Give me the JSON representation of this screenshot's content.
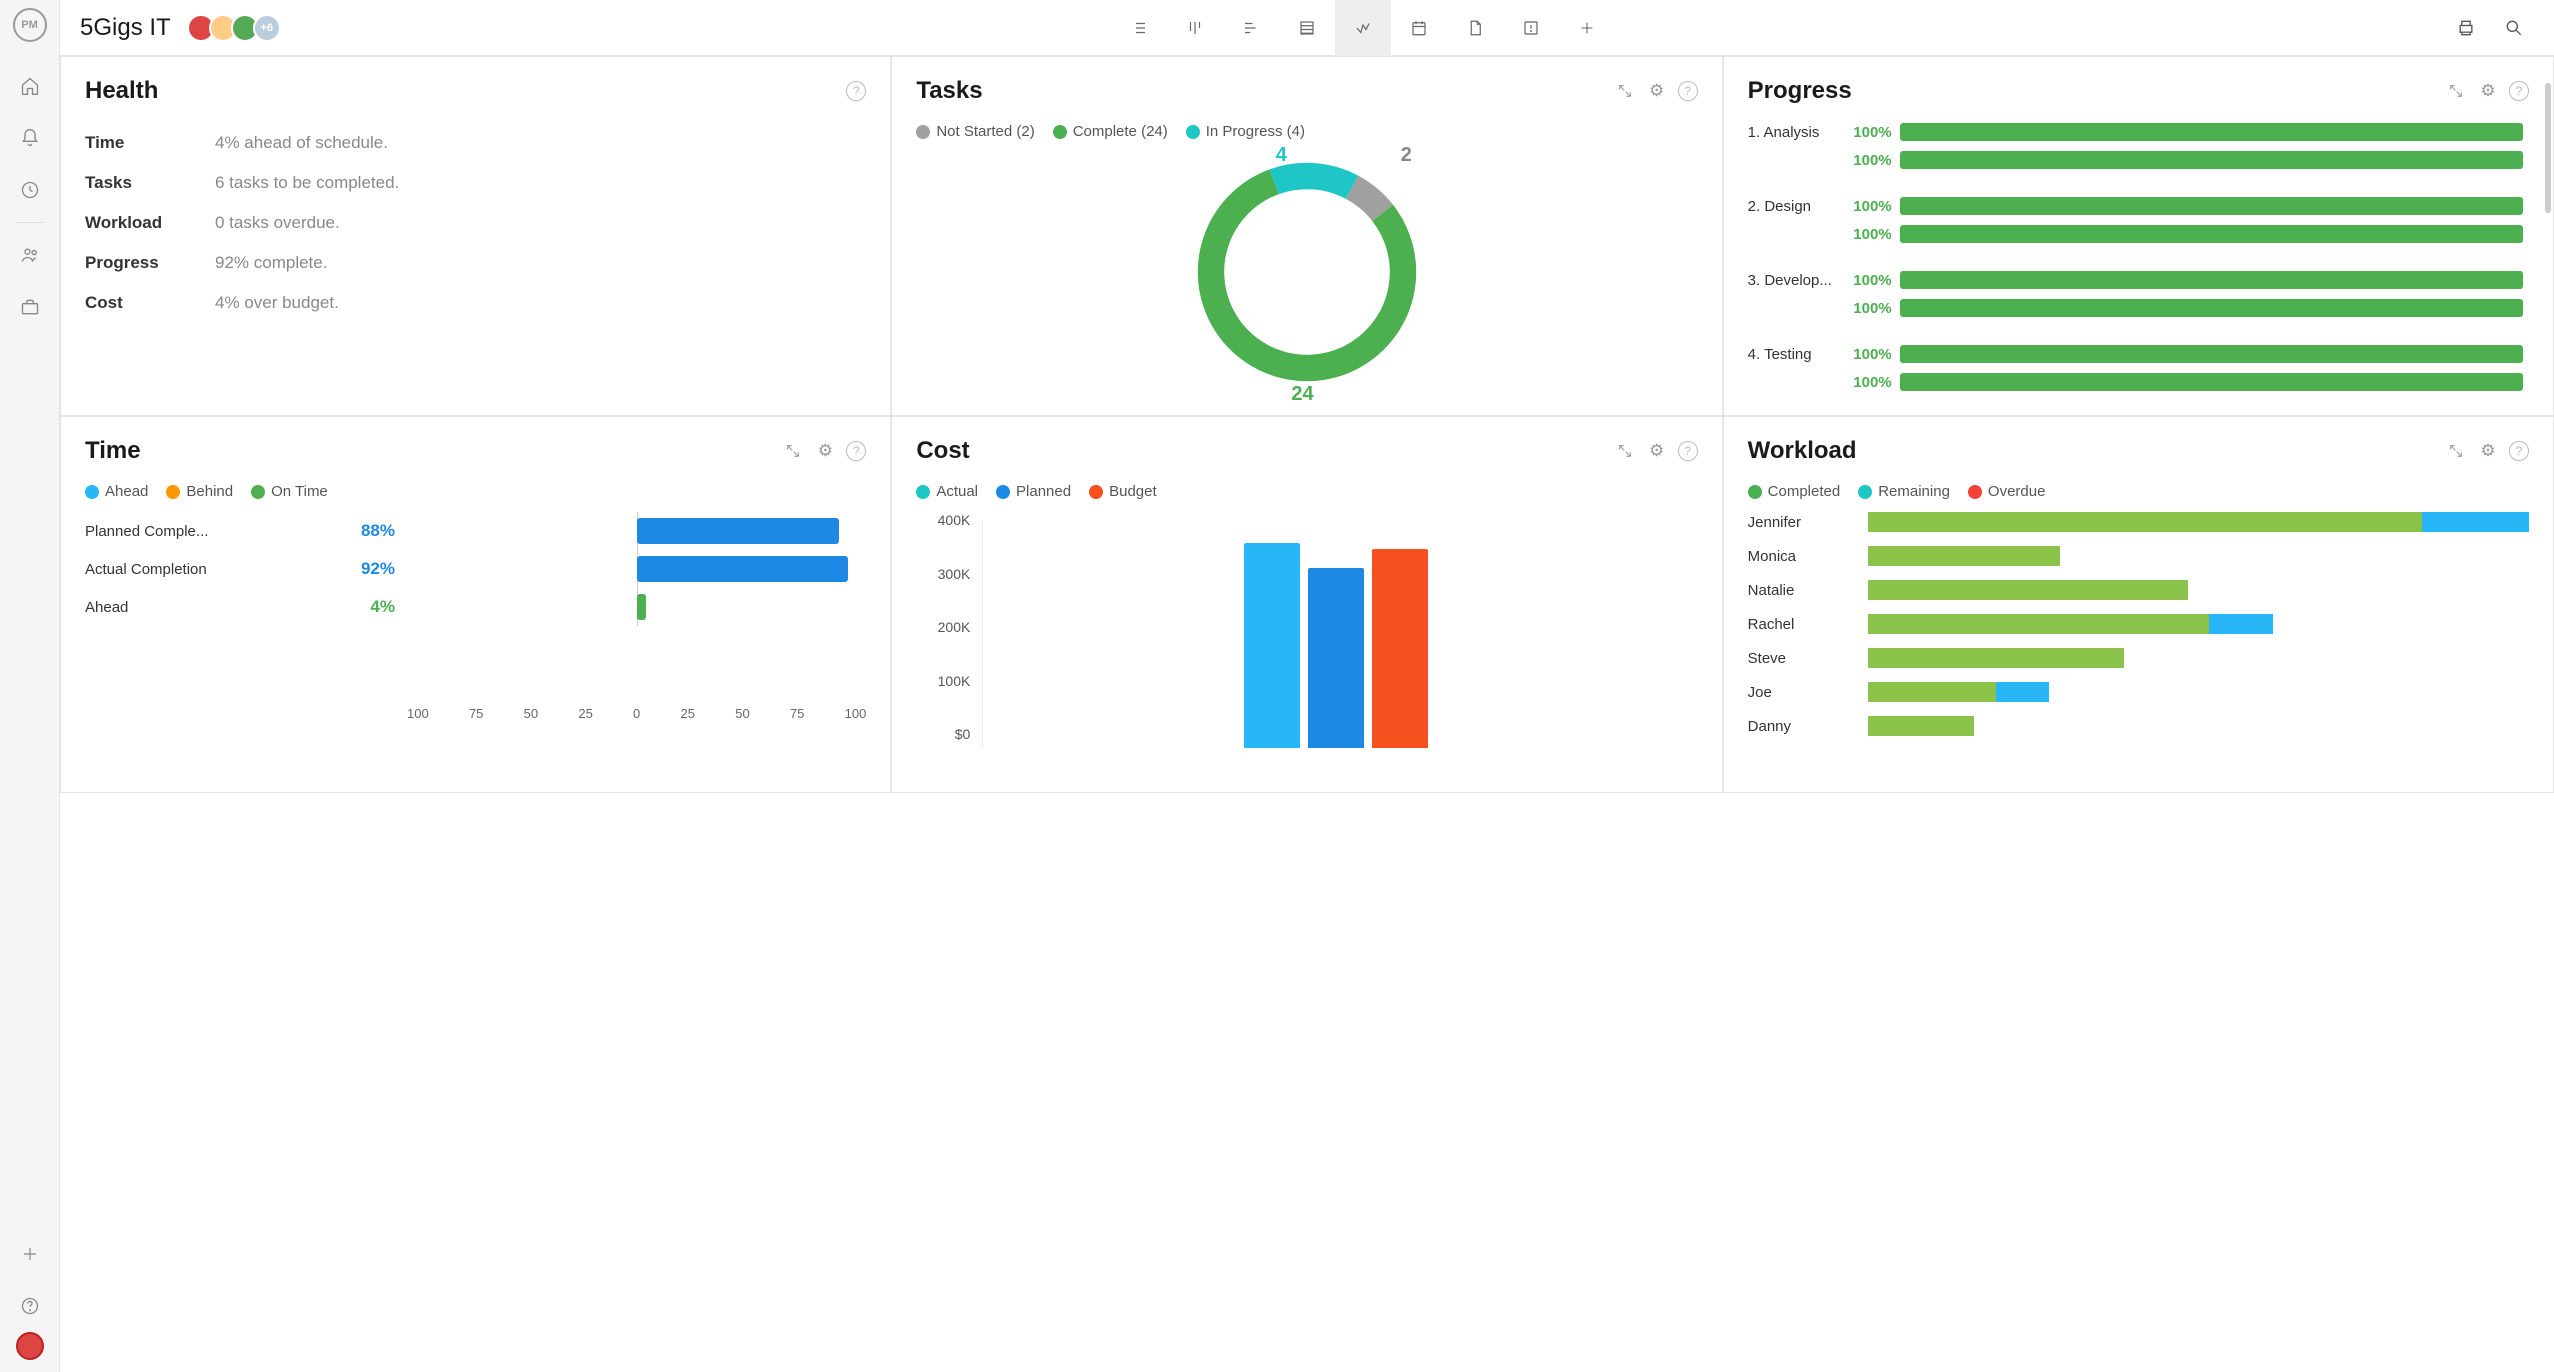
{
  "app": {
    "logo": "PM",
    "project_title": "5Gigs IT"
  },
  "avatars": {
    "more_label": "+6"
  },
  "colors": {
    "green": "#4caf50",
    "teal": "#1fc6c6",
    "blue": "#1e88e5",
    "lightblue": "#29b6f6",
    "orange": "#f4511e",
    "grey": "#a0a0a0",
    "olive": "#8bc34a"
  },
  "health": {
    "title": "Health",
    "rows": [
      {
        "label": "Time",
        "value": "4% ahead of schedule."
      },
      {
        "label": "Tasks",
        "value": "6 tasks to be completed."
      },
      {
        "label": "Workload",
        "value": "0 tasks overdue."
      },
      {
        "label": "Progress",
        "value": "92% complete."
      },
      {
        "label": "Cost",
        "value": "4% over budget."
      }
    ]
  },
  "tasks": {
    "title": "Tasks",
    "legend": [
      {
        "label": "Not Started (2)",
        "color": "#a0a0a0",
        "value": 2
      },
      {
        "label": "Complete (24)",
        "color": "#4caf50",
        "value": 24
      },
      {
        "label": "In Progress (4)",
        "color": "#1fc6c6",
        "value": 4
      }
    ],
    "labels": {
      "not_started": "2",
      "in_progress": "4",
      "complete": "24"
    }
  },
  "progress": {
    "title": "Progress",
    "groups": [
      {
        "name": "1. Analysis",
        "bars": [
          100,
          100
        ]
      },
      {
        "name": "2. Design",
        "bars": [
          100,
          100
        ]
      },
      {
        "name": "3. Develop...",
        "bars": [
          100,
          100
        ]
      },
      {
        "name": "4. Testing",
        "bars": [
          100,
          100
        ]
      }
    ]
  },
  "time": {
    "title": "Time",
    "legend": [
      {
        "label": "Ahead",
        "color": "#29b6f6"
      },
      {
        "label": "Behind",
        "color": "#ff9800"
      },
      {
        "label": "On Time",
        "color": "#4caf50"
      }
    ],
    "rows": [
      {
        "label": "Planned Comple...",
        "pct": "88%",
        "value": 88,
        "color": "#1e88e5"
      },
      {
        "label": "Actual Completion",
        "pct": "92%",
        "value": 92,
        "color": "#1e88e5"
      },
      {
        "label": "Ahead",
        "pct": "4%",
        "value": 4,
        "color": "#4caf50"
      }
    ],
    "axis": [
      "100",
      "75",
      "50",
      "25",
      "0",
      "25",
      "50",
      "75",
      "100"
    ]
  },
  "cost": {
    "title": "Cost",
    "legend": [
      {
        "label": "Actual",
        "color": "#1fc6c6"
      },
      {
        "label": "Planned",
        "color": "#1e88e5"
      },
      {
        "label": "Budget",
        "color": "#f4511e"
      }
    ],
    "y_ticks": [
      "400K",
      "300K",
      "200K",
      "100K",
      "$0"
    ],
    "bars": [
      {
        "name": "Actual",
        "value": 360,
        "color": "#29b6f6"
      },
      {
        "name": "Planned",
        "value": 315,
        "color": "#1e88e5"
      },
      {
        "name": "Budget",
        "value": 350,
        "color": "#f4511e"
      }
    ],
    "y_max": 400
  },
  "workload": {
    "title": "Workload",
    "legend": [
      {
        "label": "Completed",
        "color": "#4caf50"
      },
      {
        "label": "Remaining",
        "color": "#1fc6c6"
      },
      {
        "label": "Overdue",
        "color": "#f44336"
      }
    ],
    "rows": [
      {
        "name": "Jennifer",
        "completed": 52,
        "remaining": 10,
        "overdue": 0
      },
      {
        "name": "Monica",
        "completed": 18,
        "remaining": 0,
        "overdue": 0
      },
      {
        "name": "Natalie",
        "completed": 30,
        "remaining": 0,
        "overdue": 0
      },
      {
        "name": "Rachel",
        "completed": 32,
        "remaining": 6,
        "overdue": 0
      },
      {
        "name": "Steve",
        "completed": 24,
        "remaining": 0,
        "overdue": 0
      },
      {
        "name": "Joe",
        "completed": 12,
        "remaining": 5,
        "overdue": 0
      },
      {
        "name": "Danny",
        "completed": 10,
        "remaining": 0,
        "overdue": 0
      }
    ],
    "max": 62
  },
  "chart_data": [
    {
      "type": "pie",
      "title": "Tasks",
      "series": [
        {
          "name": "Not Started",
          "value": 2
        },
        {
          "name": "In Progress",
          "value": 4
        },
        {
          "name": "Complete",
          "value": 24
        }
      ]
    },
    {
      "type": "bar",
      "title": "Progress",
      "categories": [
        "1. Analysis",
        "1. Analysis",
        "2. Design",
        "2. Design",
        "3. Development",
        "3. Development",
        "4. Testing",
        "4. Testing"
      ],
      "values": [
        100,
        100,
        100,
        100,
        100,
        100,
        100,
        100
      ],
      "xlabel": "",
      "ylabel": "%",
      "ylim": [
        0,
        100
      ]
    },
    {
      "type": "bar",
      "title": "Time",
      "categories": [
        "Planned Completion",
        "Actual Completion",
        "Ahead"
      ],
      "values": [
        88,
        92,
        4
      ],
      "xlabel": "",
      "ylabel": "%",
      "ylim": [
        -100,
        100
      ]
    },
    {
      "type": "bar",
      "title": "Cost",
      "categories": [
        "Actual",
        "Planned",
        "Budget"
      ],
      "values": [
        360000,
        315000,
        350000
      ],
      "xlabel": "",
      "ylabel": "$",
      "ylim": [
        0,
        400000
      ]
    },
    {
      "type": "bar",
      "title": "Workload",
      "categories": [
        "Jennifer",
        "Monica",
        "Natalie",
        "Rachel",
        "Steve",
        "Joe",
        "Danny"
      ],
      "series": [
        {
          "name": "Completed",
          "values": [
            52,
            18,
            30,
            32,
            24,
            12,
            10
          ]
        },
        {
          "name": "Remaining",
          "values": [
            10,
            0,
            0,
            6,
            0,
            5,
            0
          ]
        },
        {
          "name": "Overdue",
          "values": [
            0,
            0,
            0,
            0,
            0,
            0,
            0
          ]
        }
      ]
    }
  ]
}
